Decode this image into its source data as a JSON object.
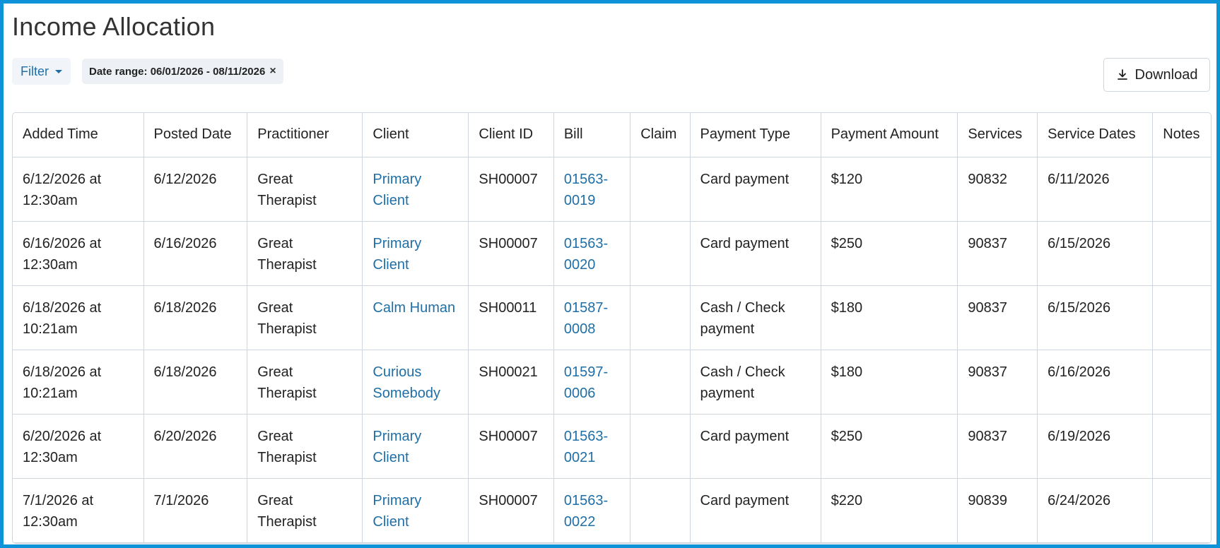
{
  "page": {
    "title": "Income Allocation"
  },
  "toolbar": {
    "filter_label": "Filter",
    "date_chip_label": "Date range: 06/01/2026 - 08/11/2026",
    "chip_close": "×",
    "download_label": "Download"
  },
  "table": {
    "headers": [
      "Added Time",
      "Posted Date",
      "Practitioner",
      "Client",
      "Client ID",
      "Bill",
      "Claim",
      "Payment Type",
      "Payment Amount",
      "Services",
      "Service Dates",
      "Notes"
    ],
    "rows": [
      {
        "added_time": "6/12/2026 at 12:30am",
        "posted_date": "6/12/2026",
        "practitioner": "Great Therapist",
        "client": "Primary Client",
        "client_id": "SH00007",
        "bill": "01563-0019",
        "claim": "",
        "payment_type": "Card payment",
        "amount": "$120",
        "services": "90832",
        "service_dates": "6/11/2026",
        "notes": ""
      },
      {
        "added_time": "6/16/2026 at 12:30am",
        "posted_date": "6/16/2026",
        "practitioner": "Great Therapist",
        "client": "Primary Client",
        "client_id": "SH00007",
        "bill": "01563-0020",
        "claim": "",
        "payment_type": "Card payment",
        "amount": "$250",
        "services": "90837",
        "service_dates": "6/15/2026",
        "notes": ""
      },
      {
        "added_time": "6/18/2026 at 10:21am",
        "posted_date": "6/18/2026",
        "practitioner": "Great Therapist",
        "client": "Calm Human",
        "client_id": "SH00011",
        "bill": "01587-0008",
        "claim": "",
        "payment_type": "Cash / Check payment",
        "amount": "$180",
        "services": "90837",
        "service_dates": "6/15/2026",
        "notes": ""
      },
      {
        "added_time": "6/18/2026 at 10:21am",
        "posted_date": "6/18/2026",
        "practitioner": "Great Therapist",
        "client": "Curious Somebody",
        "client_id": "SH00021",
        "bill": "01597-0006",
        "claim": "",
        "payment_type": "Cash / Check payment",
        "amount": "$180",
        "services": "90837",
        "service_dates": "6/16/2026",
        "notes": ""
      },
      {
        "added_time": "6/20/2026 at 12:30am",
        "posted_date": "6/20/2026",
        "practitioner": "Great Therapist",
        "client": "Primary Client",
        "client_id": "SH00007",
        "bill": "01563-0021",
        "claim": "",
        "payment_type": "Card payment",
        "amount": "$250",
        "services": "90837",
        "service_dates": "6/19/2026",
        "notes": ""
      },
      {
        "added_time": "7/1/2026 at 12:30am",
        "posted_date": "7/1/2026",
        "practitioner": "Great Therapist",
        "client": "Primary Client",
        "client_id": "SH00007",
        "bill": "01563-0022",
        "claim": "",
        "payment_type": "Card payment",
        "amount": "$220",
        "services": "90839",
        "service_dates": "6/24/2026",
        "notes": ""
      }
    ]
  },
  "colors": {
    "frame": "#0e93d8",
    "link": "#1f6fa6",
    "border": "#cfd6de"
  }
}
